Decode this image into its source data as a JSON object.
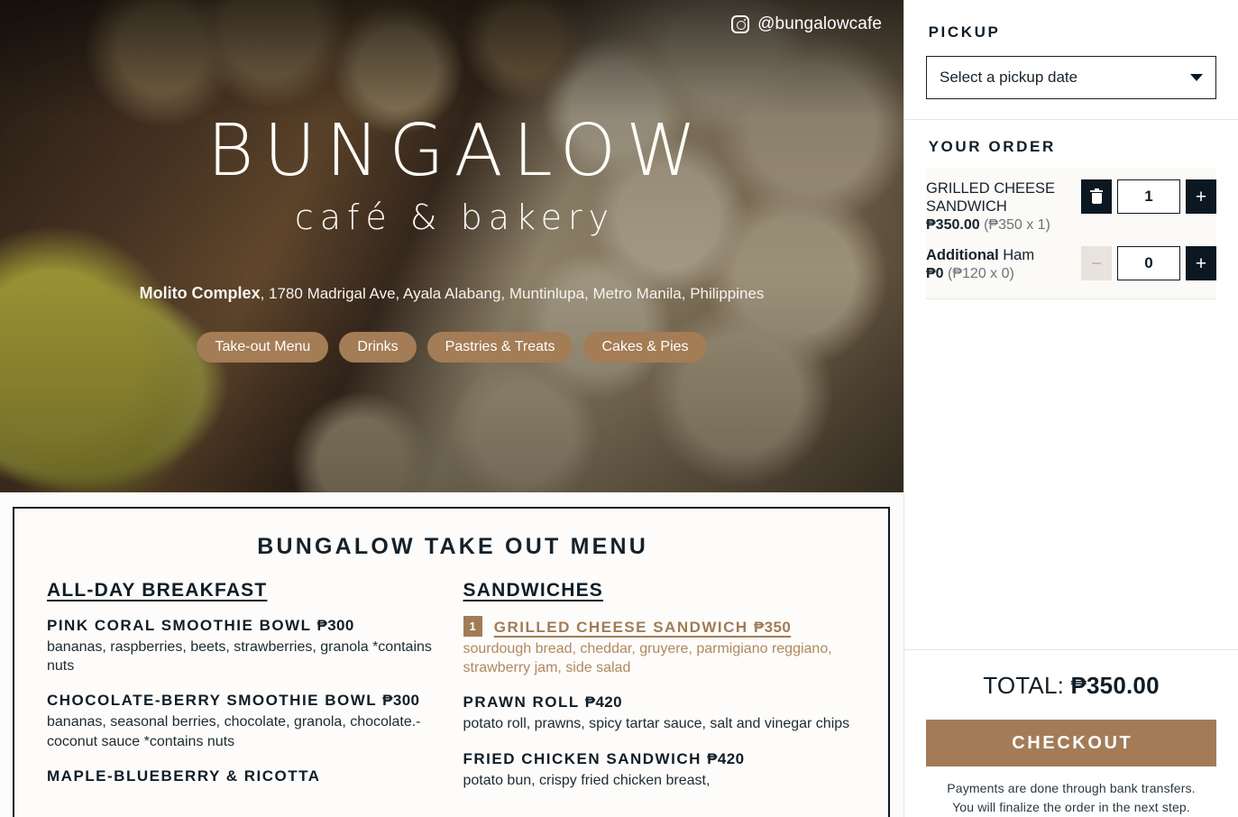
{
  "hero": {
    "instagram_handle": "@bungalowcafe",
    "brand_name": "BUNGALOW",
    "brand_sub": "café & bakery",
    "address_bold": "Molito Complex",
    "address_rest": ", 1780 Madrigal Ave, Ayala Alabang, Muntinlupa, Metro Manila, Philippines",
    "nav_pills": [
      {
        "label": "Take-out Menu"
      },
      {
        "label": "Drinks"
      },
      {
        "label": "Pastries & Treats"
      },
      {
        "label": "Cakes & Pies"
      }
    ]
  },
  "menu": {
    "title": "BUNGALOW TAKE OUT MENU",
    "columns": [
      {
        "heading": "ALL-DAY BREAKFAST",
        "items": [
          {
            "name": "PINK CORAL SMOOTHIE BOWL",
            "price": "₱300",
            "desc": "bananas, raspberries, beets, strawberries, granola *contains nuts",
            "selected": false,
            "qty_badge": ""
          },
          {
            "name": "CHOCOLATE-BERRY SMOOTHIE BOWL",
            "price": "₱300",
            "desc": "bananas, seasonal berries, chocolate, granola, chocolate.-coconut sauce *contains nuts",
            "selected": false,
            "qty_badge": ""
          },
          {
            "name": "MAPLE-BLUEBERRY & RICOTTA",
            "price": "",
            "desc": "",
            "selected": false,
            "qty_badge": ""
          }
        ]
      },
      {
        "heading": "SANDWICHES",
        "items": [
          {
            "name": "GRILLED CHEESE SANDWICH",
            "price": "₱350",
            "desc": "sourdough bread, cheddar, gruyere, parmigiano reggiano, strawberry jam, side salad",
            "selected": true,
            "qty_badge": "1"
          },
          {
            "name": "PRAWN ROLL",
            "price": "₱420",
            "desc": "potato roll, prawns, spicy tartar sauce, salt and vinegar chips",
            "selected": false,
            "qty_badge": ""
          },
          {
            "name": "FRIED CHICKEN SANDWICH",
            "price": "₱420",
            "desc": "potato bun, crispy fried chicken breast,",
            "selected": false,
            "qty_badge": ""
          }
        ]
      }
    ]
  },
  "sidebar": {
    "pickup": {
      "title": "PICKUP",
      "select_value": "Select a pickup date"
    },
    "order": {
      "title": "YOUR ORDER",
      "rows": [
        {
          "name": "GRILLED CHEESE SANDWICH",
          "sub_label": "",
          "price_total": "₱350.00",
          "price_calc": "(₱350 x 1)",
          "qty": "1",
          "left_button": "trash",
          "left_disabled": false,
          "plus_label": "+"
        },
        {
          "name": "Ham",
          "sub_label": "Additional",
          "price_total": "₱0",
          "price_calc": "(₱120 x 0)",
          "qty": "0",
          "left_button": "minus",
          "left_disabled": true,
          "plus_label": "+"
        }
      ]
    },
    "totals": {
      "label": "TOTAL: ",
      "amount": "₱350.00",
      "checkout_label": "CHECKOUT",
      "note_line1": "Payments are done through bank transfers.",
      "note_line2": "You will finalize the order in the next step."
    }
  },
  "colors": {
    "brand_brown": "#a37c57",
    "dark": "#0b1821",
    "cream": "#fbfaf6"
  }
}
